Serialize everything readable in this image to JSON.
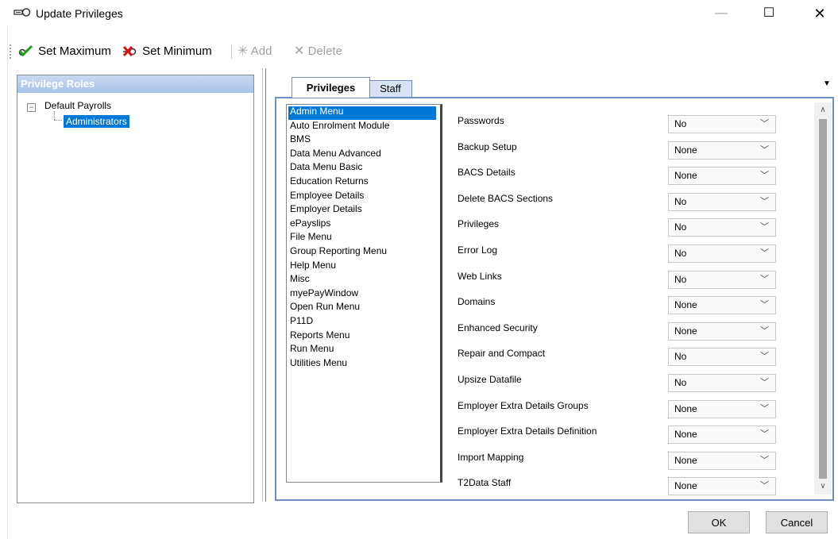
{
  "window": {
    "title": "Update Privileges",
    "minimize_glyph": "—",
    "maximize_glyph": "☐",
    "close_glyph": "✕",
    "title_icon": "key-icon"
  },
  "toolbar": {
    "set_maximum_label": "Set Maximum",
    "set_minimum_label": "Set Minimum",
    "add_label": "Add",
    "delete_label": "Delete",
    "set_maximum_icon": "green-check-key-icon",
    "set_minimum_icon": "red-cross-key-icon",
    "add_icon": "sparkle-add-icon",
    "delete_icon": "cross-delete-icon"
  },
  "roles_panel": {
    "header": "Privilege Roles",
    "tree_root": "Default Payrolls",
    "tree_root_expander": "−",
    "tree_child": "Administrators"
  },
  "tabs": {
    "privileges_label": "Privileges",
    "staff_label": "Staff",
    "active": "Privileges",
    "dropdown_glyph": "▼"
  },
  "menu_list": [
    "Admin Menu",
    "Auto Enrolment Module",
    "BMS",
    "Data Menu Advanced",
    "Data Menu Basic",
    "Education Returns",
    "Employee Details",
    "Employer Details",
    "ePayslips",
    "File Menu",
    "Group Reporting Menu",
    "Help Menu",
    "Misc",
    "myePayWindow",
    "Open Run Menu",
    "P11D",
    "Reports Menu",
    "Run Menu",
    "Utilities Menu"
  ],
  "selected_menu": "Admin Menu",
  "privileges": [
    {
      "label": "Passwords",
      "value": "No"
    },
    {
      "label": "Backup Setup",
      "value": "None"
    },
    {
      "label": "BACS Details",
      "value": "None"
    },
    {
      "label": "Delete BACS Sections",
      "value": "No"
    },
    {
      "label": "Privileges",
      "value": "No"
    },
    {
      "label": "Error Log",
      "value": "No"
    },
    {
      "label": "Web Links",
      "value": "No"
    },
    {
      "label": "Domains",
      "value": "None"
    },
    {
      "label": "Enhanced Security",
      "value": "None"
    },
    {
      "label": "Repair and Compact",
      "value": "No"
    },
    {
      "label": "Upsize Datafile",
      "value": "No"
    },
    {
      "label": "Employer Extra Details Groups",
      "value": "None"
    },
    {
      "label": "Employer Extra Details Definition",
      "value": "None"
    },
    {
      "label": "Import Mapping",
      "value": "None"
    },
    {
      "label": "T2Data Staff",
      "value": "None"
    }
  ],
  "select_chevron": "﹀",
  "scrollbar": {
    "up_glyph": "∧",
    "down_glyph": "∨"
  },
  "buttons": {
    "ok_label": "OK",
    "cancel_label": "Cancel"
  }
}
